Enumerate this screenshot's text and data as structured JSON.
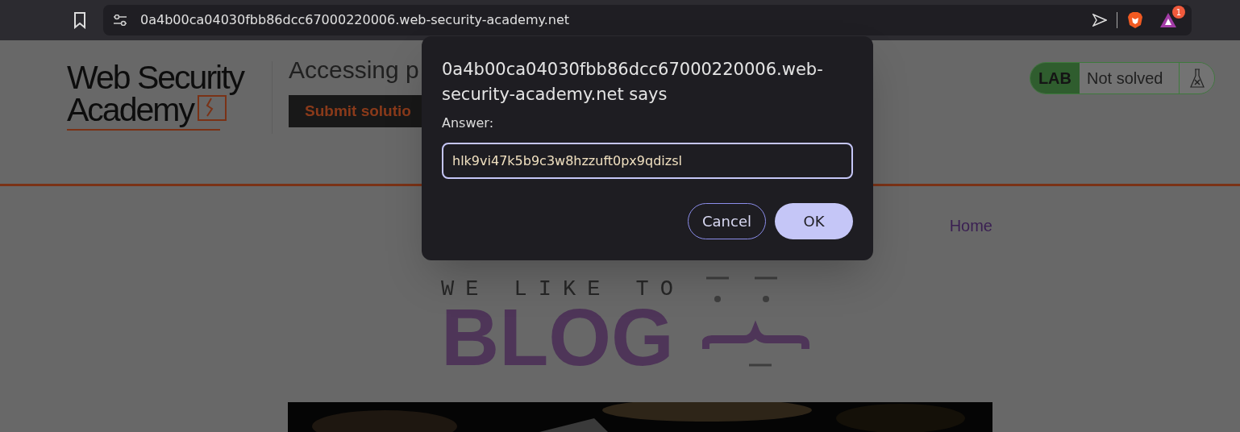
{
  "browser": {
    "url": "0a4b00ca04030fbb86dcc67000220006.web-security-academy.net",
    "notification_count": "1"
  },
  "header": {
    "logo_line_1": "Web Security",
    "logo_line_2": "Academy",
    "title": "Accessing p",
    "submit_button": "Submit solutio"
  },
  "lab_status": {
    "tag": "LAB",
    "status": "Not solved"
  },
  "nav": [
    {
      "label": "Home"
    }
  ],
  "blog_logo": {
    "tagline": "WE LIKE TO",
    "word": "BLOG"
  },
  "dialog": {
    "title": "0a4b00ca04030fbb86dcc67000220006.web-security-academy.net says",
    "label": "Answer:",
    "value": "hlk9vi47k5b9c3w8hzzuft0px9qdizsl",
    "buttons": [
      {
        "label": "Cancel",
        "kind": "secondary"
      },
      {
        "label": "OK",
        "kind": "primary"
      }
    ]
  }
}
